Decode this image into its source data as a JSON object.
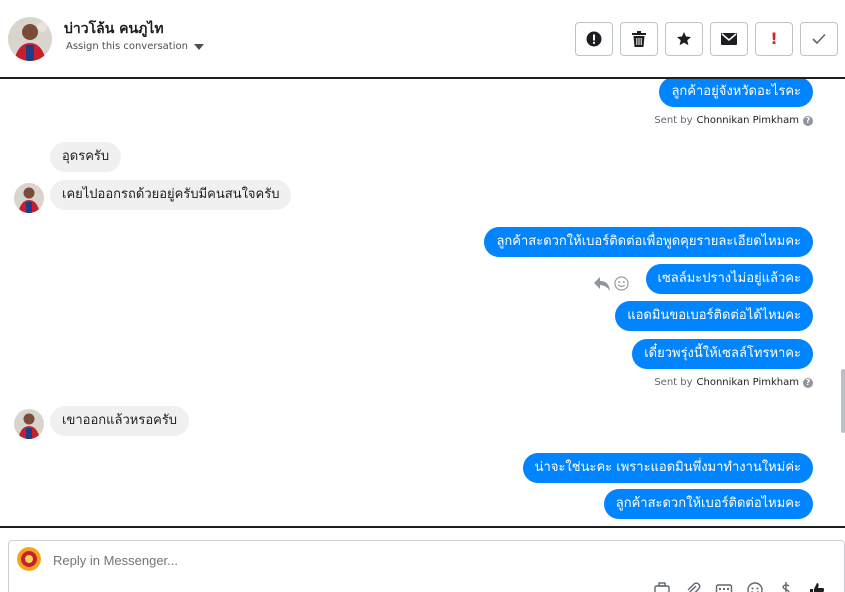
{
  "header": {
    "contact_name": "บ่าวโล้น คนภูไท",
    "assign_label": "Assign this conversation",
    "actions": [
      {
        "name": "spam",
        "icon": "exclamation-circle-icon"
      },
      {
        "name": "delete",
        "icon": "trash-icon"
      },
      {
        "name": "star",
        "icon": "star-icon"
      },
      {
        "name": "mark-unread",
        "icon": "envelope-icon"
      },
      {
        "name": "flag-important",
        "icon": "exclamation-icon"
      },
      {
        "name": "mark-done",
        "icon": "checkmark-icon"
      }
    ]
  },
  "conversation": {
    "messages": [
      {
        "dir": "out",
        "text": "ลูกค้าอยู่จังหวัดอะไรคะ"
      },
      {
        "dir": "in",
        "text": "อุดรครับ"
      },
      {
        "dir": "in",
        "text": "เคยไปออกรถด้วยอยู่ครับมีคนสนใจครับ"
      },
      {
        "dir": "out",
        "text": "ลูกค้าสะดวกให้เบอร์ติดต่อเพื่อพูดคุยรายละเอียดไหมคะ"
      },
      {
        "dir": "out",
        "text": "เซลล์มะปรางไม่อยู่แล้วคะ"
      },
      {
        "dir": "out",
        "text": "แอดมินขอเบอร์ติดต่อได้ไหมคะ"
      },
      {
        "dir": "out",
        "text": "เดี๋ยวพรุ่งนี้ให้เซลล์โทรหาคะ"
      },
      {
        "dir": "in",
        "text": "เขาออกแล้วหรอครับ"
      },
      {
        "dir": "out",
        "text": "น่าจะใช่นะคะ เพราะแอดมินพึ่งมาทำงานใหม่ค่ะ"
      },
      {
        "dir": "out",
        "text": "ลูกค้าสะดวกให้เบอร์ติดต่อไหมคะ"
      }
    ],
    "sent_by_prefix": "Sent by",
    "sent_by_name": "Chonnikan Pimkham"
  },
  "composer": {
    "placeholder": "Reply in Messenger..."
  },
  "colors": {
    "outgoing_bubble": "#0084ff",
    "incoming_bubble": "#f1f0f0"
  }
}
